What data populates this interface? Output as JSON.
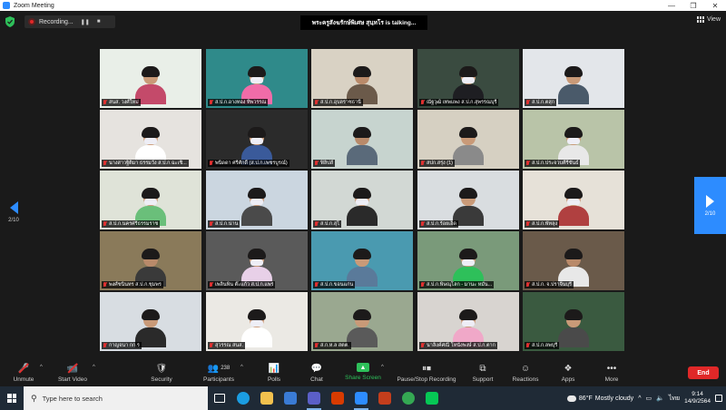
{
  "window": {
    "title": "Zoom Meeting",
    "minimize": "—",
    "maximize": "❐",
    "close": "✕"
  },
  "topbar": {
    "recording_label": "Recording...",
    "pause_icon": "❚❚",
    "stop_icon": "■",
    "speaker_text": "พระครูสังฆรักษ์พิเศษ สุนฺทโร is talking...",
    "view_label": "View"
  },
  "nav": {
    "left_page": "2/10",
    "right_page": "2/10"
  },
  "tiles": [
    {
      "label": "สนส. วงศ์ใหม่",
      "bg": "#e9efe8",
      "skin": "#c99a78",
      "body": "#c44a6a",
      "mask": false
    },
    {
      "label": "ส.ป.ก.อางทอง ทิพวรรณ",
      "bg": "#2f8a8a",
      "skin": "#d0a584",
      "body": "#f06ca8",
      "mask": true
    },
    {
      "label": "ส.ป.ก.อุบลราชธานี",
      "bg": "#d9d2c4",
      "skin": "#b98a6a",
      "body": "#6b5a4a",
      "mask": false
    },
    {
      "label": "ณัฐวุฒิ เทพแพง ส.ป.ก.สุพรรณบุรี",
      "bg": "#3a4b40",
      "skin": "#c99a78",
      "body": "#1e1e22",
      "mask": true
    },
    {
      "label": "ส.ป.ก.ตสุก",
      "bg": "#e3e6ea",
      "skin": "#c99a78",
      "body": "#4a5a6a",
      "mask": false
    },
    {
      "label": "นางสาวฐิติมา ธรรมวัง ส.ป.ก.ฉะเชิ...",
      "bg": "#e6e3df",
      "skin": "#cfa080",
      "body": "#ffffff",
      "mask": true
    },
    {
      "label": "พนิดดา ศรีศักดิ์ (ส.ป.ก.เพชรบูรณ์)",
      "bg": "#2b2b2b",
      "skin": "#c99a78",
      "body": "#3a5a9a",
      "mask": true
    },
    {
      "label": "ฟิลิปส์",
      "bg": "#c7d4cf",
      "skin": "#b98a6a",
      "body": "#5a6a7a",
      "mask": false
    },
    {
      "label": "สปก.สรุ่ง (1)",
      "bg": "#d6d0c2",
      "skin": "#c99a78",
      "body": "#8a8a8a",
      "mask": false
    },
    {
      "label": "ส.ป.ก.ประจวบคีรีขันธ์",
      "bg": "#b9c4a8",
      "skin": "#c99a78",
      "body": "#e8e8e8",
      "mask": true
    },
    {
      "label": "ส.ป.ก.นครศรีธรรมราช",
      "bg": "#dfe3d8",
      "skin": "#c99a78",
      "body": "#6abf7a",
      "mask": true
    },
    {
      "label": "ส.ป.ก.น่าน",
      "bg": "#cbd6e0",
      "skin": "#c99a78",
      "body": "#4a4a4a",
      "mask": true
    },
    {
      "label": "ส.ป.ก.สุโ",
      "bg": "#d2d8d4",
      "skin": "#c99a78",
      "body": "#2a2a2a",
      "mask": true
    },
    {
      "label": "ส.ป.ก.ร้อยเอ็ด",
      "bg": "#d9dde0",
      "skin": "#c99a78",
      "body": "#3a3a3a",
      "mask": false
    },
    {
      "label": "ส.ป.ก.พัทลุง",
      "bg": "#e6e1d8",
      "skin": "#c99a78",
      "body": "#b04040",
      "mask": true
    },
    {
      "label": "พงศ์ชนินทร ส.ป.ก.ชุมพร",
      "bg": "#8a7a5a",
      "skin": "#b98a6a",
      "body": "#3a3a3a",
      "mask": false
    },
    {
      "label": "เพลินพิน ต๊ะแก้ว ส.ป.ก.แพร่",
      "bg": "#5a5a5a",
      "skin": "#c99a78",
      "body": "#e8d0e8",
      "mask": true
    },
    {
      "label": "ส.ป.ก.ขอนแก่น",
      "bg": "#4a9ab0",
      "skin": "#c99a78",
      "body": "#5a7a9a",
      "mask": false
    },
    {
      "label": "ส.ป.ก.พิษณุโลก - มานะ หมั่น...",
      "bg": "#7a9a7a",
      "skin": "#c99a78",
      "body": "#2ec05a",
      "mask": true
    },
    {
      "label": "ส.ป.ก. จ.ปราจีนบุรี",
      "bg": "#6a5a4a",
      "skin": "#b98a6a",
      "body": "#e8e8e8",
      "mask": false
    },
    {
      "label": "กาญจนา กก.ร",
      "bg": "#d8dde2",
      "skin": "#c99a78",
      "body": "#2a2a2a",
      "mask": false
    },
    {
      "label": "สุวรรณ สนส.",
      "bg": "#ebe9e4",
      "skin": "#cfa080",
      "body": "#ffffff",
      "mask": true
    },
    {
      "label": "ส.ก.ห.ล สตต.",
      "bg": "#9aa890",
      "skin": "#c99a78",
      "body": "#5a5a5a",
      "mask": false
    },
    {
      "label": "นาลิงค์ศณี โหนังพงษ์ ส.ป.ก.ตาก",
      "bg": "#d8d4d0",
      "skin": "#c99a78",
      "body": "#f0a8c8",
      "mask": true
    },
    {
      "label": "ส.ป.ก.ลพบุรี",
      "bg": "#3a5a40",
      "skin": "#c99a78",
      "body": "#4a4a4a",
      "mask": false
    }
  ],
  "toolbar": {
    "unmute": "Unmute",
    "start_video": "Start Video",
    "security": "Security",
    "participants": "Participants",
    "participant_count": "238",
    "polls": "Polls",
    "chat": "Chat",
    "share_screen": "Share Screen",
    "pause_stop_recording": "Pause/Stop Recording",
    "support": "Support",
    "reactions": "Reactions",
    "apps": "Apps",
    "more": "More",
    "end": "End"
  },
  "taskbar": {
    "search_placeholder": "Type here to search",
    "temperature": "86°F",
    "weather": "Mostly cloudy",
    "language": "ไทย",
    "time": "9:14",
    "date": "14/9/2564",
    "apps": [
      {
        "name": "task-view",
        "color": "#ffffff"
      },
      {
        "name": "edge",
        "color": "#1b9de2"
      },
      {
        "name": "file-explorer",
        "color": "#f2c14e"
      },
      {
        "name": "mail",
        "color": "#3a7bd5"
      },
      {
        "name": "teams",
        "color": "#5b5fc7"
      },
      {
        "name": "office",
        "color": "#d83b01"
      },
      {
        "name": "zoom",
        "color": "#2d8cff"
      },
      {
        "name": "powerpoint",
        "color": "#c43e1c"
      },
      {
        "name": "chrome",
        "color": "#34a853"
      },
      {
        "name": "line",
        "color": "#06c755"
      }
    ]
  }
}
